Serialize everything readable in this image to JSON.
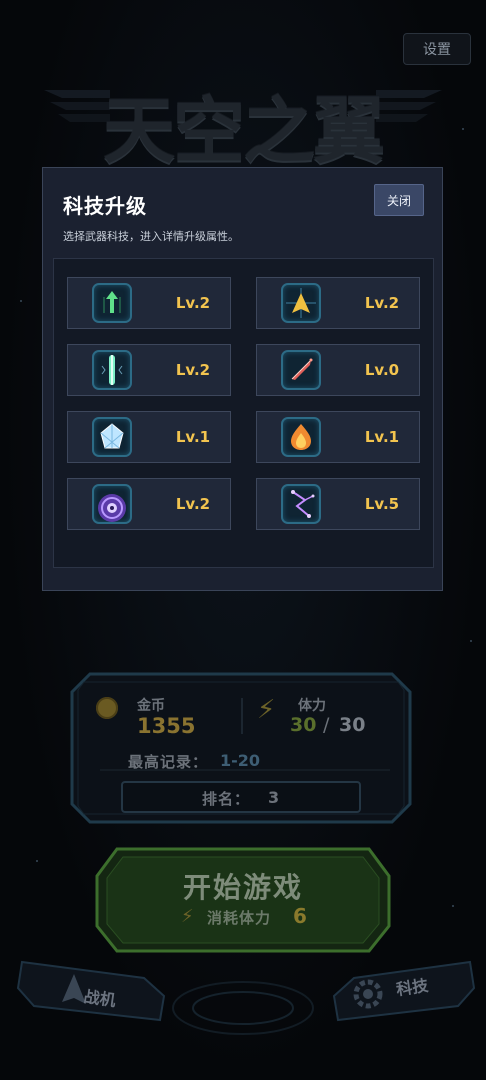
{
  "settings_label": "设置",
  "game_title": "天空之翼",
  "modal": {
    "title": "科技升级",
    "subtitle": "选择武器科技，进入详情升级属性。",
    "close_label": "关闭",
    "items": [
      {
        "icon": "green-arrow-icon",
        "level": "Lv.2"
      },
      {
        "icon": "golden-jet-icon",
        "level": "Lv.2"
      },
      {
        "icon": "laser-beam-icon",
        "level": "Lv.2"
      },
      {
        "icon": "sword-icon",
        "level": "Lv.0"
      },
      {
        "icon": "ice-crystal-icon",
        "level": "Lv.1"
      },
      {
        "icon": "fireball-icon",
        "level": "Lv.1"
      },
      {
        "icon": "shield-wave-icon",
        "level": "Lv.2"
      },
      {
        "icon": "lightning-chain-icon",
        "level": "Lv.5"
      }
    ]
  },
  "stats": {
    "coin_label": "金币",
    "coin_value": "1355",
    "stamina_label": "体力",
    "stamina_current": "30",
    "stamina_sep": "/",
    "stamina_max": "30",
    "record_label": "最高记录：",
    "record_value": "1-20",
    "rank_label": "排名：",
    "rank_value": "3"
  },
  "start": {
    "label": "开始游戏",
    "cost_label": "消耗体力",
    "cost_value": "6"
  },
  "nav": {
    "fighter_label": "战机",
    "tech_label": "科技"
  },
  "colors": {
    "modal_bg": "#1b2130",
    "level_text": "#f2c44f",
    "close_button": "#3a4766"
  }
}
